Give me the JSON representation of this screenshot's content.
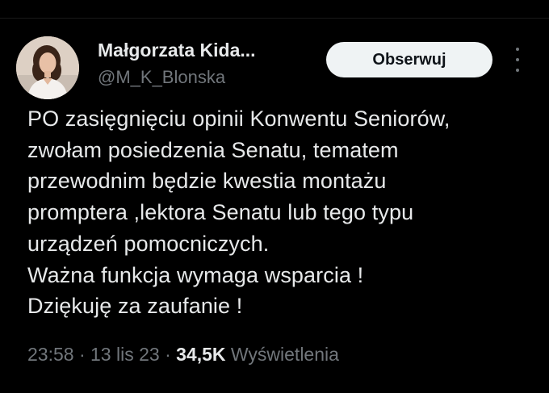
{
  "author": {
    "display_name": "Małgorzata Kida...",
    "handle": "@M_K_Blonska",
    "avatar": "profile-photo"
  },
  "follow_button": {
    "label": "Obserwuj"
  },
  "more_menu": {
    "icon": "more-vertical-icon"
  },
  "tweet": {
    "lines": [
      "PO zasięgnięciu opinii Konwentu Seniorów,",
      "zwołam posiedzenia Senatu, tematem",
      "przewodnim będzie kwestia montażu",
      "promptera ,lektora Senatu lub tego typu",
      "urządzeń pomocniczych.",
      "Ważna funkcja wymaga wsparcia !",
      "Dziękuję za zaufanie !"
    ]
  },
  "meta": {
    "time": "23:58",
    "date": "13 lis 23",
    "separator": "·",
    "views_count": "34,5K",
    "views_label": "Wyświetlenia"
  },
  "colors": {
    "background": "#000000",
    "text": "#e7e9ea",
    "secondary_text": "#71767b",
    "button_bg": "#eff3f4",
    "button_text": "#0f1419"
  }
}
